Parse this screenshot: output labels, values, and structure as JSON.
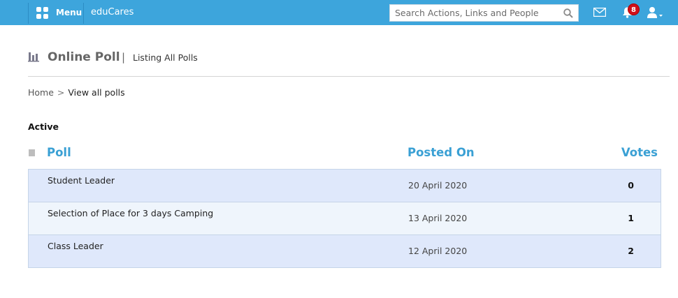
{
  "topbar": {
    "menu_label": "Menu",
    "brand": "eduCares",
    "search_placeholder": "Search Actions, Links and People",
    "notification_count": "8",
    "bar_color": "#3da5dc"
  },
  "header": {
    "title": "Online Poll",
    "separator": "|",
    "subtitle": "Listing All Polls"
  },
  "breadcrumb": {
    "home": "Home",
    "arrow": ">",
    "current": "View all polls"
  },
  "section": {
    "label": "Active"
  },
  "table": {
    "columns": {
      "poll": "Poll",
      "posted_on": "Posted On",
      "votes": "Votes"
    },
    "rows": [
      {
        "name": "Student Leader",
        "posted_on": "20 April 2020",
        "votes": "0"
      },
      {
        "name": "Selection of Place for 3 days Camping",
        "posted_on": "13 April 2020",
        "votes": "1"
      },
      {
        "name": "Class Leader",
        "posted_on": "12 April 2020",
        "votes": "2"
      }
    ],
    "row_colors": [
      "#dfe8fb",
      "#eff5fc",
      "#dfe8fb"
    ],
    "header_color": "#3aa0d4"
  }
}
